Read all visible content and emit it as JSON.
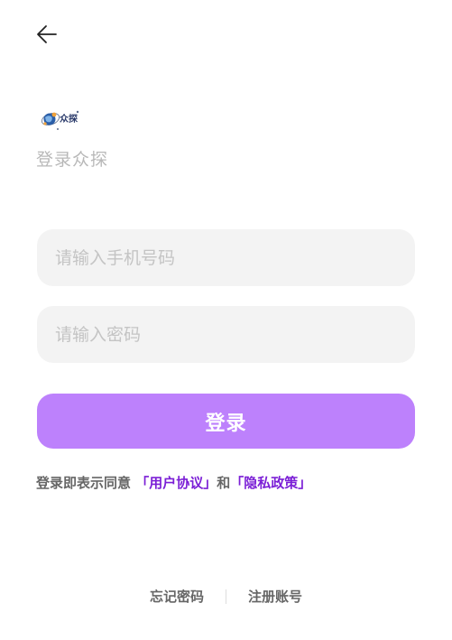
{
  "header": {
    "back_icon": "arrow-left-icon"
  },
  "brand": {
    "logo_icon": "zhongtan-logo-icon",
    "logo_text": "众探",
    "logo_colors": [
      "#2a5ea8",
      "#f0a23a",
      "#5a6b8c"
    ]
  },
  "title": "登录众探",
  "form": {
    "phone_placeholder": "请输入手机号码",
    "phone_value": "",
    "password_placeholder": "请输入密码",
    "password_value": "",
    "login_label": "登录"
  },
  "agreement": {
    "prefix": "登录即表示同意",
    "user_agreement": "「用户协议」",
    "conjunction": "和",
    "privacy_policy": "「隐私政策」"
  },
  "footer": {
    "forgot_password": "忘记密码",
    "register": "注册账号"
  },
  "colors": {
    "accent": "#bd81fc",
    "link": "#7b1fd6",
    "input_bg": "#f3f3f3",
    "placeholder": "#c4c4c4"
  }
}
